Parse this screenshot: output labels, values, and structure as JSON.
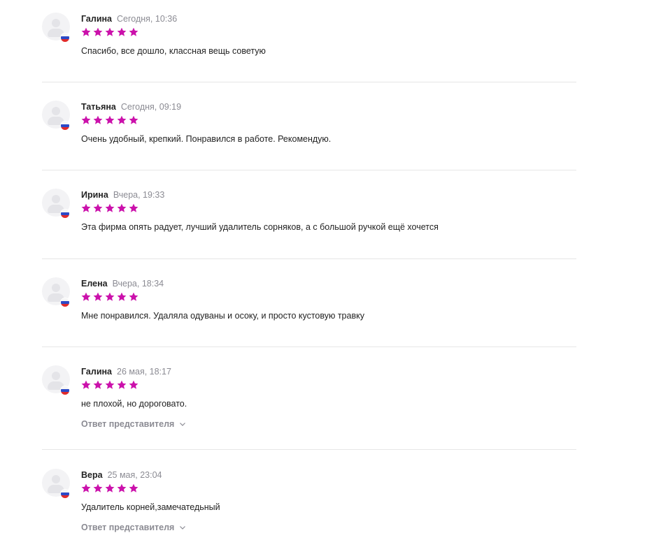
{
  "colors": {
    "star": "#cb11ab",
    "muted": "#8b8b93",
    "divider": "#e6e6e6"
  },
  "icons": {
    "avatar": "user-avatar-icon",
    "flag": "russia-flag-icon",
    "star": "star-icon",
    "chevron": "chevron-down-icon"
  },
  "reviews": [
    {
      "author": "Галина",
      "date": "Сегодня, 10:36",
      "rating": 5,
      "text": "Спасибо, все дошло, классная вещь советую",
      "rep_reply": null
    },
    {
      "author": "Татьяна",
      "date": "Сегодня, 09:19",
      "rating": 5,
      "text": "Очень удобный, крепкий. Понравился в работе. Рекомендую.",
      "rep_reply": null
    },
    {
      "author": "Ирина",
      "date": "Вчера, 19:33",
      "rating": 5,
      "text": "Эта фирма опять радует, лучший удалитель сорняков, а с большой ручкой ещё хочется",
      "rep_reply": null
    },
    {
      "author": "Елена",
      "date": "Вчера, 18:34",
      "rating": 5,
      "text": "Мне понравился. Удаляла одуваны и осоку, и просто кустовую травку",
      "rep_reply": null
    },
    {
      "author": "Галина",
      "date": "26 мая, 18:17",
      "rating": 5,
      "text": "не плохой, но дороговато.",
      "rep_reply": "Ответ представителя"
    },
    {
      "author": "Вера",
      "date": "25 мая, 23:04",
      "rating": 5,
      "text": "Удалитель корней,замечатедьный",
      "rep_reply": "Ответ представителя"
    }
  ]
}
